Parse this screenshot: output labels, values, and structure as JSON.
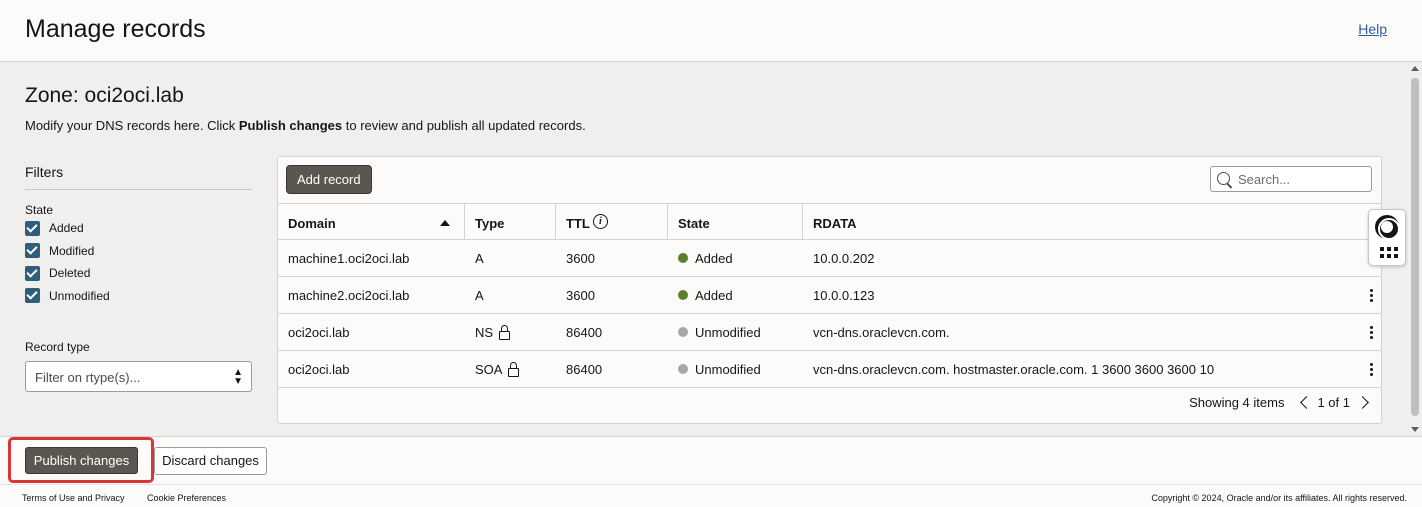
{
  "header": {
    "title": "Manage records",
    "help": "Help"
  },
  "zone": {
    "title": "Zone: oci2oci.lab",
    "desc_pre": "Modify your DNS records here. Click ",
    "desc_bold": "Publish changes",
    "desc_post": " to review and publish all updated records."
  },
  "filters": {
    "title": "Filters",
    "state_label": "State",
    "states": [
      {
        "label": "Added",
        "checked": true
      },
      {
        "label": "Modified",
        "checked": true
      },
      {
        "label": "Deleted",
        "checked": true
      },
      {
        "label": "Unmodified",
        "checked": true
      }
    ],
    "record_type_label": "Record type",
    "record_type_placeholder": "Filter on rtype(s)..."
  },
  "toolbar": {
    "add_record": "Add record",
    "search_placeholder": "Search..."
  },
  "table": {
    "columns": {
      "domain": "Domain",
      "type": "Type",
      "ttl": "TTL",
      "state": "State",
      "rdata": "RDATA"
    },
    "rows": [
      {
        "domain": "machine1.oci2oci.lab",
        "type": "A",
        "locked": false,
        "ttl": "3600",
        "state": "Added",
        "state_color": "#5b7f2a",
        "rdata": "10.0.0.202",
        "menu": false
      },
      {
        "domain": "machine2.oci2oci.lab",
        "type": "A",
        "locked": false,
        "ttl": "3600",
        "state": "Added",
        "state_color": "#5b7f2a",
        "rdata": "10.0.0.123",
        "menu": true
      },
      {
        "domain": "oci2oci.lab",
        "type": "NS",
        "locked": true,
        "ttl": "86400",
        "state": "Unmodified",
        "state_color": "#a9a7a5",
        "rdata": "vcn-dns.oraclevcn.com.",
        "menu": true
      },
      {
        "domain": "oci2oci.lab",
        "type": "SOA",
        "locked": true,
        "ttl": "86400",
        "state": "Unmodified",
        "state_color": "#a9a7a5",
        "rdata": "vcn-dns.oraclevcn.com. hostmaster.oracle.com. 1 3600 3600 3600 10",
        "menu": true
      }
    ],
    "showing": "Showing 4 items",
    "page": "1 of 1"
  },
  "actions": {
    "publish": "Publish changes",
    "discard": "Discard changes"
  },
  "footer": {
    "terms": "Terms of Use and Privacy",
    "cookies": "Cookie Preferences",
    "copyright": "Copyright © 2024, Oracle and/or its affiliates. All rights reserved."
  },
  "colors": {
    "accent": "#2e5e7a",
    "highlight": "#d8363a",
    "primary_button": "#5c5650"
  }
}
